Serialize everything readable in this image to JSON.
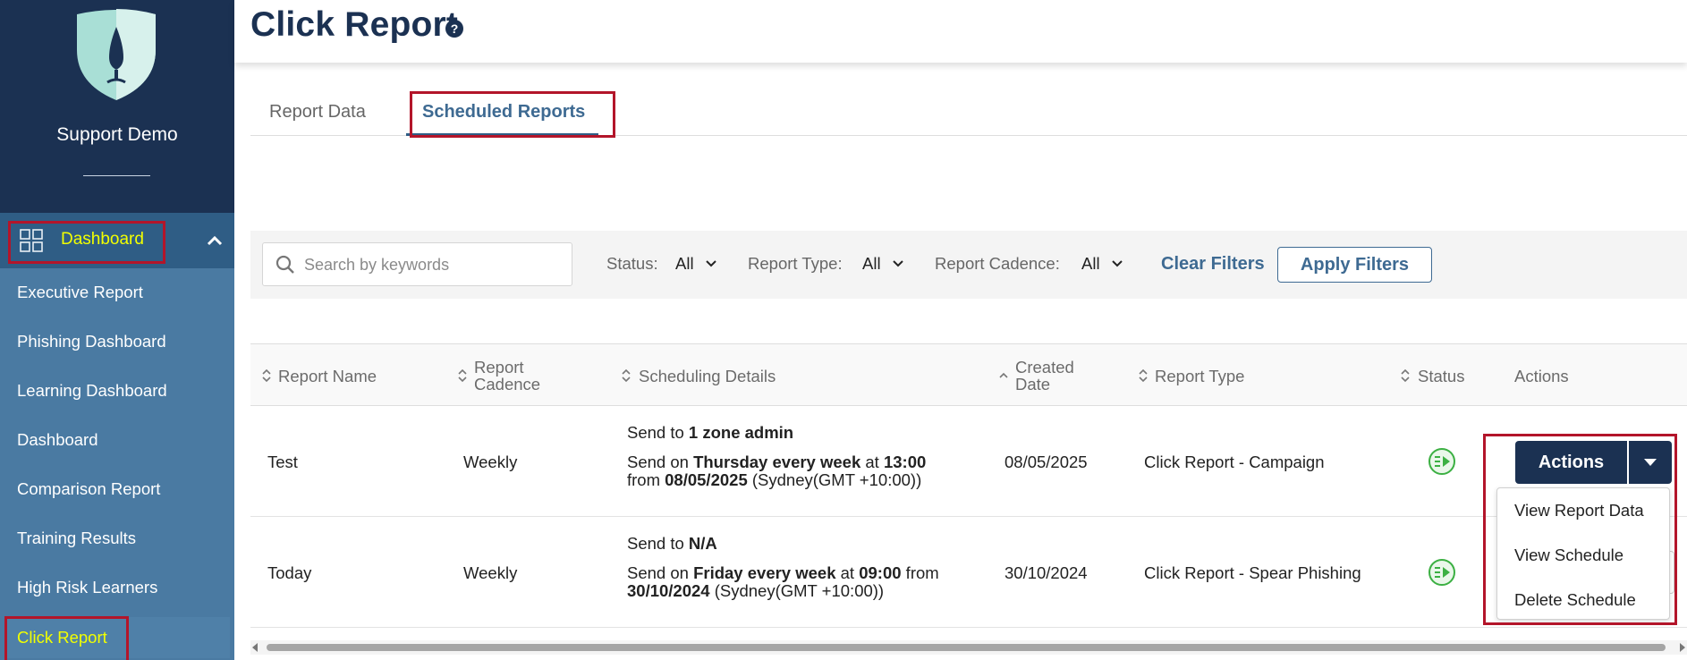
{
  "sidebar": {
    "org_name": "Support Demo",
    "dashboard_label": "Dashboard",
    "items": [
      {
        "label": "Executive Report"
      },
      {
        "label": "Phishing Dashboard"
      },
      {
        "label": "Learning Dashboard"
      },
      {
        "label": "Dashboard"
      },
      {
        "label": "Comparison Report"
      },
      {
        "label": "Training Results"
      },
      {
        "label": "High Risk Learners"
      },
      {
        "label": "Click Report"
      }
    ],
    "active_color": "#f2ff00"
  },
  "header": {
    "title": "Click Report",
    "help_glyph": "?"
  },
  "tabs": [
    {
      "label": "Report Data",
      "active": false
    },
    {
      "label": "Scheduled Reports",
      "active": true
    }
  ],
  "filters": {
    "search_placeholder": "Search by keywords",
    "status_label": "Status:",
    "status_value": "All",
    "type_label": "Report Type:",
    "type_value": "All",
    "cadence_label": "Report Cadence:",
    "cadence_value": "All",
    "clear_label": "Clear Filters",
    "apply_label": "Apply Filters"
  },
  "table": {
    "columns": [
      {
        "label": "Report Name"
      },
      {
        "label_line1": "Report",
        "label_line2": "Cadence"
      },
      {
        "label": "Scheduling Details"
      },
      {
        "label_line1": "Created",
        "label_line2": "Date"
      },
      {
        "label": "Report Type"
      },
      {
        "label": "Status"
      },
      {
        "label": "Actions"
      }
    ],
    "rows": [
      {
        "name": "Test",
        "cadence": "Weekly",
        "send_to_prefix": "Send to ",
        "send_to": "1 zone admin",
        "send_on_prefix": "Send on ",
        "send_on": "Thursday every week",
        "at_text": " at ",
        "time": "13:00",
        "from_text": "from ",
        "from_date": "08/05/2025",
        "tz": " (Sydney(GMT +10:00))",
        "created": "08/05/2025",
        "type": "Click Report - Campaign",
        "status_icon": "play-active-icon"
      },
      {
        "name": "Today",
        "cadence": "Weekly",
        "send_to_prefix": "Send to ",
        "send_to": "N/A",
        "send_on_prefix": "Send on ",
        "send_on": "Friday every week",
        "at_text": " at ",
        "time": "09:00",
        "from_text": " from",
        "from_date": "30/10/2024",
        "tz": " (Sydney(GMT +10:00))",
        "created": "30/10/2024",
        "type": "Click Report - Spear Phishing",
        "status_icon": "play-active-icon"
      }
    ]
  },
  "actions": {
    "button_label": "Actions",
    "menu": [
      {
        "label": "View Report Data"
      },
      {
        "label": "View Schedule"
      },
      {
        "label": "Delete Schedule"
      }
    ]
  },
  "colors": {
    "navy": "#1b3152",
    "sidebar_blue": "#4a7aa2",
    "highlight_red": "#b3152a",
    "status_green": "#3cb043"
  }
}
